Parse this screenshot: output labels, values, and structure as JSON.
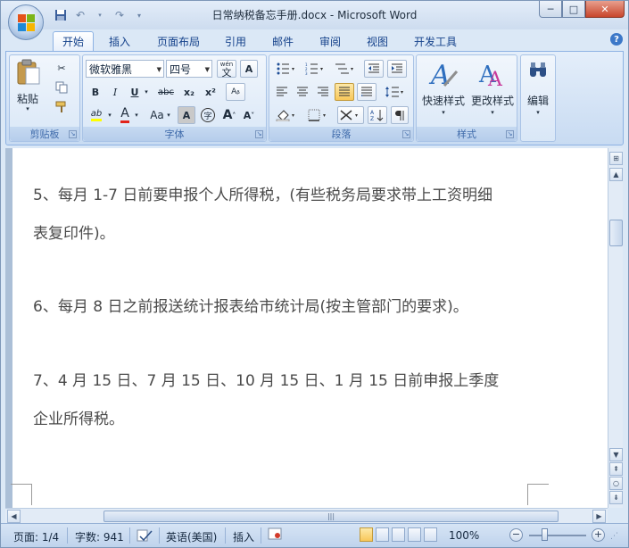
{
  "window": {
    "title": "日常纳税备忘手册.docx - Microsoft Word",
    "controls": {
      "minimize": "─",
      "maximize": "□",
      "close": "✕"
    }
  },
  "quick_access": {
    "save_icon": "save-icon",
    "undo_icon": "undo-icon",
    "redo_icon": "redo-icon",
    "customize_icon": "customize-icon"
  },
  "ribbon_tabs": [
    "开始",
    "插入",
    "页面布局",
    "引用",
    "邮件",
    "审阅",
    "视图",
    "开发工具"
  ],
  "clipboard_group": {
    "title": "剪贴板",
    "paste_label": "粘贴"
  },
  "font_group": {
    "title": "字体",
    "font_name": "微软雅黑",
    "font_size": "四号",
    "bold": "B",
    "italic": "I",
    "underline": "U",
    "strikethrough": "abc",
    "subscript": "x₂",
    "superscript": "x²",
    "grow_font": "A",
    "shrink_font": "A",
    "font_color": "A",
    "change_case": "Aa",
    "highlight": "ab",
    "wen": "wén",
    "char_border": "A",
    "char_shading": "A",
    "enclose": "字"
  },
  "paragraph_group": {
    "title": "段落"
  },
  "styles_group": {
    "title": "样式",
    "quick_styles_label": "快速样式",
    "change_styles_label": "更改样式"
  },
  "editing_group": {
    "label": "编辑"
  },
  "document": {
    "lines": [
      "5、每月 1-7 日前要申报个人所得税，(有些税务局要求带上工资明细",
      "表复印件)。",
      "6、每月 8 日之前报送统计报表给市统计局(按主管部门的要求)。",
      "7、4 月 15 日、7 月 15 日、10 月 15 日、1 月 15 日前申报上季度",
      "企业所得税。"
    ]
  },
  "status_bar": {
    "page": "页面: 1/4",
    "word_count": "字数: 941",
    "language": "英语(美国)",
    "insert_mode": "插入",
    "zoom": "100%",
    "zoom_out": "−",
    "zoom_in": "+"
  },
  "colors": {
    "ribbon_blue": "#c8dbf2",
    "text": "#4a4a4a",
    "font_color_red": "#e2231a",
    "highlight_yellow": "#ffff00"
  }
}
